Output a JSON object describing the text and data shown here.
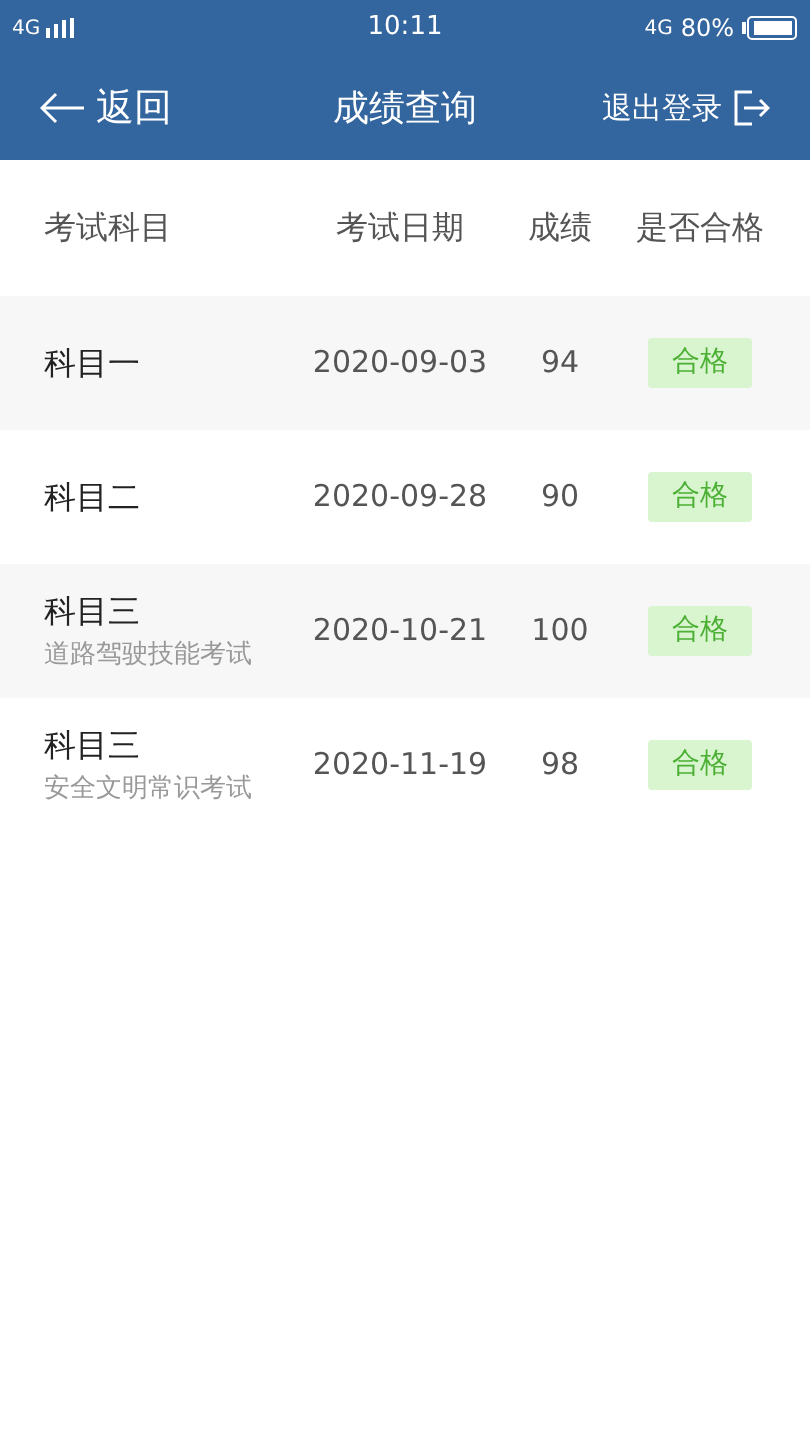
{
  "status_bar": {
    "network_left": "4G",
    "time": "10:11",
    "network_right": "4G",
    "battery": "80%"
  },
  "nav": {
    "back": "返回",
    "title": "成绩查询",
    "logout": "退出登录"
  },
  "table": {
    "columns": [
      "考试科目",
      "考试日期",
      "成绩",
      "是否合格"
    ],
    "rows": [
      {
        "subject": "科目一",
        "date": "2020-09-03",
        "score": "94",
        "result": "合格",
        "passed": true
      },
      {
        "subject": "科目二",
        "date": "2020-09-28",
        "score": "90",
        "result": "合格",
        "passed": true
      },
      {
        "subject": "科目三",
        "detail": "道路驾驶技能考试",
        "date": "2020-10-21",
        "score": "100",
        "result": "合格",
        "passed": true
      },
      {
        "subject": "科目三",
        "detail": "安全文明常识考试",
        "date": "2020-11-19",
        "score": "98",
        "result": "合格",
        "passed": true
      }
    ]
  }
}
